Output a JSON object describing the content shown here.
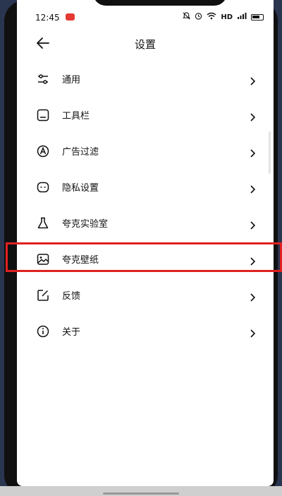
{
  "status_bar": {
    "time": "12:45",
    "network": "HD",
    "icons": [
      "alarm-off-icon",
      "alarm-clock-icon",
      "wifi-icon",
      "signal-icon",
      "battery-icon"
    ],
    "app_notification_color": "#e53935"
  },
  "header": {
    "title": "设置",
    "back_icon": "arrow-left-icon"
  },
  "menu": {
    "items": [
      {
        "label": "通用",
        "icon": "sliders-icon"
      },
      {
        "label": "工具栏",
        "icon": "toolbar-icon"
      },
      {
        "label": "广告过滤",
        "icon": "ad-block-icon"
      },
      {
        "label": "隐私设置",
        "icon": "privacy-icon"
      },
      {
        "label": "夸克实验室",
        "icon": "flask-icon"
      },
      {
        "label": "夸克壁纸",
        "icon": "wallpaper-icon",
        "highlighted": true
      },
      {
        "label": "反馈",
        "icon": "feedback-icon"
      },
      {
        "label": "关于",
        "icon": "info-icon"
      }
    ]
  },
  "colors": {
    "highlight": "#e02020",
    "text": "#111111",
    "background": "#ffffff"
  }
}
